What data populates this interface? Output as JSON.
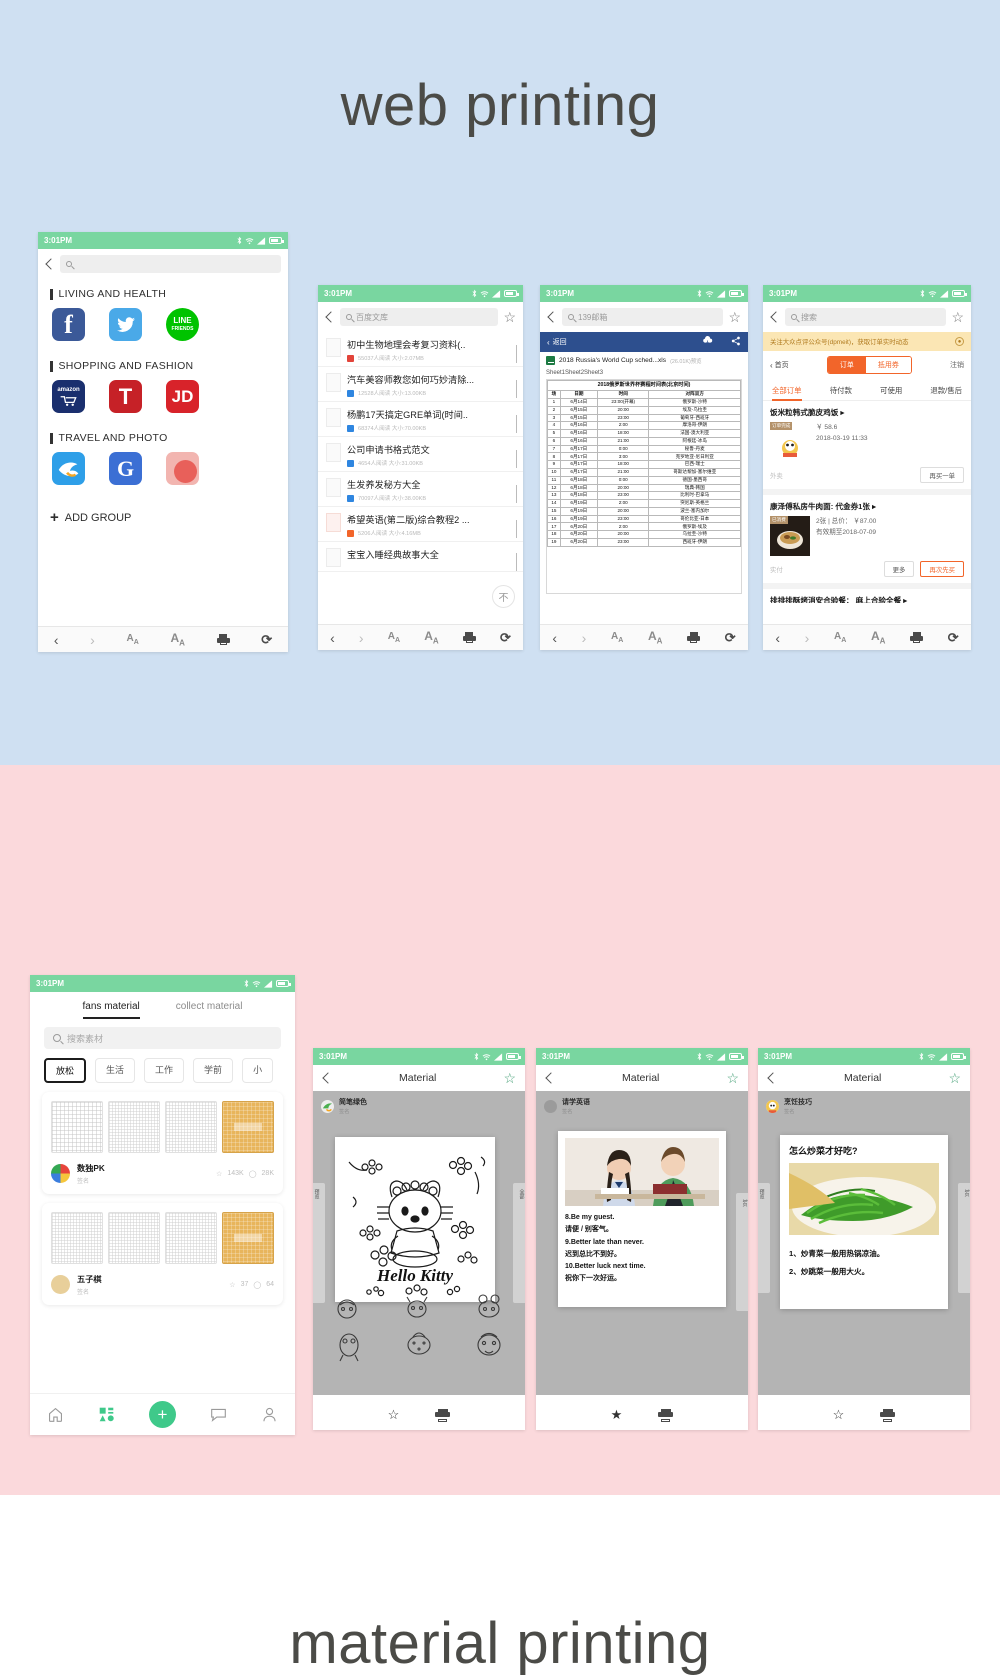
{
  "sections": {
    "web": {
      "title": "web printing",
      "bg": "#cfe0f2"
    },
    "material": {
      "title": "material printing",
      "bg": "#fbd9dc"
    }
  },
  "status_bar": {
    "time": "3:01PM",
    "icons": [
      "bluetooth-icon",
      "wifi-icon",
      "signal-icon",
      "battery-icon"
    ]
  },
  "toolbar": {
    "back": "‹",
    "forward": "›",
    "text_smaller": "A",
    "text_larger": "A",
    "print": "print-icon",
    "reload": "⟳"
  },
  "phone1": {
    "search_placeholder": "",
    "groups": [
      {
        "title": "LIVING AND HEALTH",
        "apps": [
          "Facebook",
          "Twitter",
          "LINE FRIENDS"
        ]
      },
      {
        "title": "SHOPPING AND FASHION",
        "apps": [
          "amazon",
          "T",
          "JD"
        ]
      },
      {
        "title": "TRAVEL AND PHOTO",
        "apps": [
          "Ctrip",
          "Google",
          "Photo"
        ]
      }
    ],
    "add_group": "ADD GROUP",
    "line_label_1": "LINE",
    "line_label_2": "FRIENDS",
    "amazon_label": "amazon",
    "t_label": "T",
    "jd_label": "JD",
    "google_label": "G"
  },
  "phone2": {
    "search_value": "百度文库",
    "docs": [
      {
        "title": "初中生物地理会考复习资料(..",
        "meta": "55037人阅读  大小:2.07MB",
        "color": "#e2443a"
      },
      {
        "title": "汽车美容师教您如何巧妙清除...",
        "meta": "12528人阅读  大小:13.00KB",
        "color": "#2f86e0"
      },
      {
        "title": "杨鹏17天搞定GRE单词(时间..",
        "meta": "68374人阅读  大小:70.00KB",
        "color": "#2f86e0"
      },
      {
        "title": "公司申请书格式范文",
        "meta": "4654人阅读  大小:31.00KB",
        "color": "#2f86e0"
      },
      {
        "title": "生发养发秘方大全",
        "meta": "70097人阅读  大小:38.00KB",
        "color": "#2f86e0"
      },
      {
        "title": "希望英语(第二版)综合教程2 ...",
        "meta": "5206人阅读  大小:4.16MB",
        "color": "#f2652a"
      },
      {
        "title": "宝宝入睡经典故事大全",
        "meta": "",
        "color": "#2f86e0"
      }
    ],
    "float_button": "不"
  },
  "phone3": {
    "search_value": "139邮箱",
    "viewer_back": "返回",
    "file_name": "2018 Russia's World Cup sched...xls",
    "file_meta": "(26.01K)预览",
    "sheet_tabs": "Sheet1Sheet2Sheet3",
    "table": {
      "caption": "2018俄罗斯世界杯赛程时间表(北京时间)",
      "headers": [
        "场",
        "日期",
        "时间",
        "对阵双方"
      ],
      "rows": [
        [
          "1",
          "6月14日",
          "23:00(开幕)",
          "俄罗斯-沙特"
        ],
        [
          "2",
          "6月15日",
          "20:00",
          "埃及-乌拉圭"
        ],
        [
          "3",
          "6月15日",
          "23:00",
          "葡萄牙-西班牙"
        ],
        [
          "4",
          "6月16日",
          "2:00",
          "摩洛哥-伊朗"
        ],
        [
          "5",
          "6月16日",
          "18:00",
          "法国-澳大利亚"
        ],
        [
          "6",
          "6月16日",
          "21:00",
          "阿根廷-冰岛"
        ],
        [
          "7",
          "6月17日",
          "0:00",
          "秘鲁-丹麦"
        ],
        [
          "8",
          "6月17日",
          "3:00",
          "克罗地亚-尼日利亚"
        ],
        [
          "9",
          "6月17日",
          "18:00",
          "巴西-瑞士"
        ],
        [
          "10",
          "6月17日",
          "21:00",
          "哥斯达黎加-塞尔维亚"
        ],
        [
          "11",
          "6月18日",
          "0:00",
          "德国-墨西哥"
        ],
        [
          "12",
          "6月18日",
          "20:00",
          "瑞典-韩国"
        ],
        [
          "13",
          "6月18日",
          "23:00",
          "比利时-巴拿马"
        ],
        [
          "14",
          "6月19日",
          "2:00",
          "突尼斯-英格兰"
        ],
        [
          "15",
          "6月19日",
          "20:00",
          "波兰-塞内加尔"
        ],
        [
          "16",
          "6月19日",
          "23:00",
          "哥伦比亚-日本"
        ],
        [
          "17",
          "6月20日",
          "2:00",
          "俄罗斯-埃及"
        ],
        [
          "18",
          "6月20日",
          "20:00",
          "乌拉圭-沙特"
        ],
        [
          "19",
          "6月20日",
          "23:00",
          "西班牙-伊朗"
        ]
      ]
    }
  },
  "phone4": {
    "search_placeholder": "搜索",
    "promo": "关注大众点评公众号(dpmeit)，获取订单实时动态",
    "home": "首页",
    "seg_on": "订单",
    "seg_off": "抵用券",
    "register": "注销",
    "tabs": [
      "全部订单",
      "待付款",
      "可使用",
      "退款/售后"
    ],
    "orders": [
      {
        "title": "饭米粒韩式脆皮鸡饭 ▸",
        "badge": "订单完成",
        "price": "￥ 58.6",
        "date": "2018-03-19 11:33",
        "left_label": "外卖",
        "buttons": [
          "再买一单"
        ]
      },
      {
        "title": "康泽傅私房牛肉面: 代金券1张 ▸",
        "badge": "已消费",
        "price": "2张 | 总价： ￥87.00",
        "date": "有效期至2018-07-09",
        "left_label": "实付",
        "buttons": [
          "更多",
          "再次先买"
        ]
      },
      {
        "title": "排排排酥烤消安合验餐： 麻上合验全餐 ▸",
        "badge": "",
        "price": "",
        "date": "",
        "left_label": "",
        "buttons": []
      }
    ]
  },
  "phone5": {
    "tabs": [
      "fans material",
      "collect material"
    ],
    "search_placeholder": "搜索素材",
    "chips": [
      "放松",
      "生活",
      "工作",
      "学前",
      "小"
    ],
    "cards": [
      {
        "name": "数独PK",
        "tag": "签名",
        "fav": "143K",
        "comments": "28K"
      },
      {
        "name": "五子棋",
        "tag": "签名",
        "fav": "37",
        "comments": "64"
      }
    ],
    "tabbar": [
      "home-icon",
      "grid-icon",
      "add-icon",
      "chat-icon",
      "profile-icon"
    ]
  },
  "material_phones": [
    {
      "title": "Material",
      "author": "简笔绿色",
      "author_tag": "签名",
      "doc_text": "Hello Kitty",
      "starred": false,
      "side_left": "预览",
      "side_right": "全部"
    },
    {
      "title": "Material",
      "author": "请学英语",
      "author_tag": "签名",
      "starred": true,
      "lines": [
        "8.Be my guest.",
        "请便 / 别客气。",
        "9.Better late than never.",
        "迟到总比不到好。",
        "10.Better luck next time.",
        "祝你下一次好运。"
      ],
      "side_left": "预览",
      "side_right": "1页"
    },
    {
      "title": "Material",
      "author": "烹饪技巧",
      "author_tag": "签名",
      "starred": false,
      "heading": "怎么炒菜才好吃?",
      "lines": [
        "1、炒青菜一般用热锅凉油。",
        "2、炒跳菜一般用大火。"
      ],
      "side_left": "预览",
      "side_right": "1页"
    }
  ],
  "colors": {
    "status_green": "#79d6a0",
    "web_bg": "#cfe0f2",
    "material_bg": "#fbd9dc",
    "accent_orange": "#f2652a",
    "accent_green": "#3fc98a"
  }
}
